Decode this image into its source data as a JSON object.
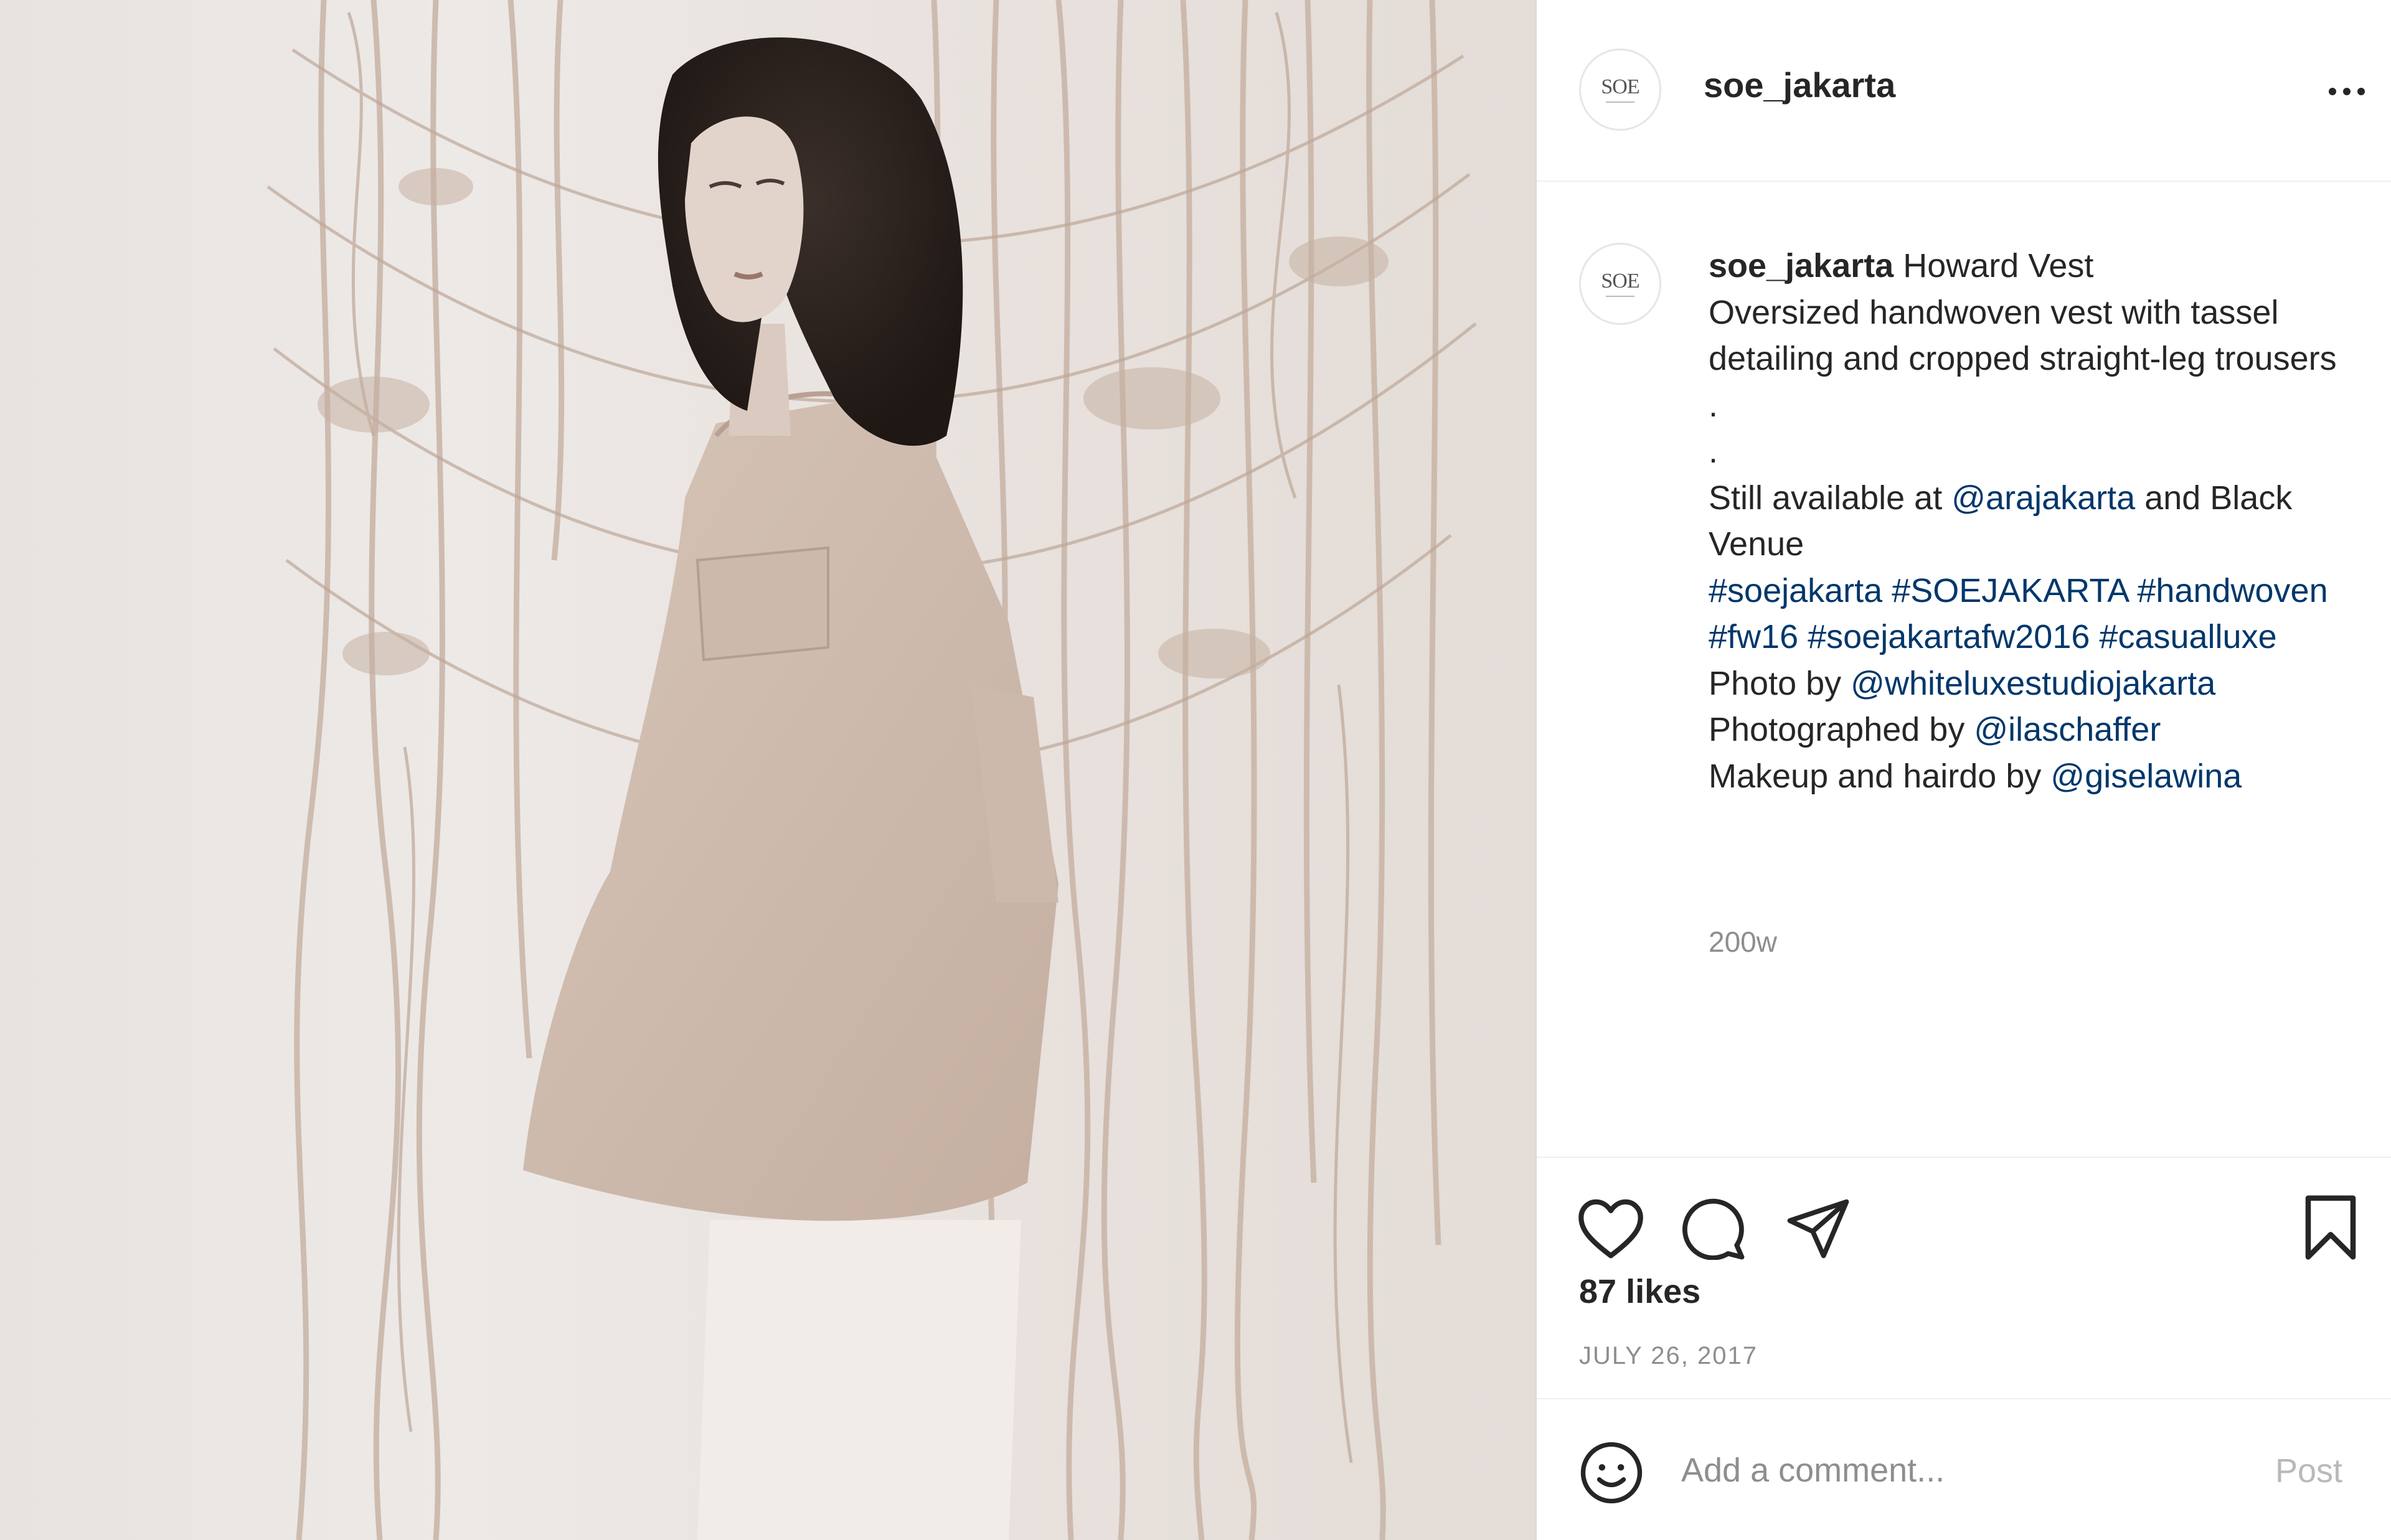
{
  "post": {
    "image_alt": "Model wearing oversized handwoven vest in front of macrame backdrop",
    "username": "soe_jakarta",
    "avatar_text": "SOE"
  },
  "caption": {
    "username": "soe_jakarta",
    "title": "Howard Vest",
    "line1": "Oversized handwoven vest with tassel detailing and cropped straight-leg trousers",
    "dot1": ".",
    "dot2": ".",
    "still_available": "Still available at ",
    "ara_link": "@arajakarta",
    "and_black_venue": " and Black Venue",
    "hashtags_1": "#soejakarta #SOEJAKARTA #handwoven #fw16 #soejakartafw2016 #casualluxe",
    "photo_by": "Photo by ",
    "photo_link": "@whiteluxestudiojakarta",
    "photographed_by": "Photographed by ",
    "photographer_link": "@ilaschaffer",
    "makeup_by": "Makeup and hairdo by ",
    "makeup_link": "@giselawina",
    "time": "200w"
  },
  "actions": {
    "likes": "87 likes",
    "date": "JULY 26, 2017"
  },
  "comment": {
    "placeholder": "Add a comment...",
    "post_label": "Post"
  },
  "colors": {
    "link": "#00376b",
    "text": "#262626",
    "muted": "#8e8e8e",
    "divider": "#efefef"
  },
  "icons": [
    "more-icon",
    "heart-icon",
    "comment-icon",
    "share-icon",
    "bookmark-icon",
    "emoji-icon"
  ]
}
